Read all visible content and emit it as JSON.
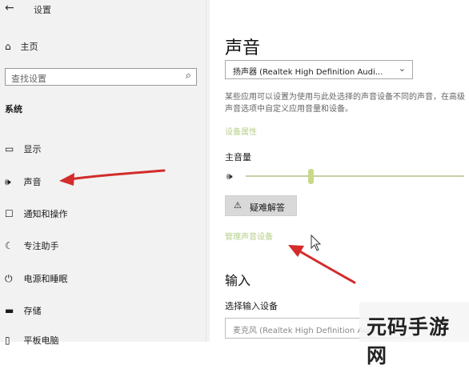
{
  "sidebar": {
    "app_title": "设置",
    "home": "主页",
    "search_placeholder": "查找设置",
    "section": "系统",
    "items": [
      {
        "label": "显示",
        "icon": "monitor-icon"
      },
      {
        "label": "声音",
        "icon": "speaker-icon"
      },
      {
        "label": "通知和操作",
        "icon": "notification-icon"
      },
      {
        "label": "专注助手",
        "icon": "moon-icon"
      },
      {
        "label": "电源和睡眠",
        "icon": "power-icon"
      },
      {
        "label": "存储",
        "icon": "storage-icon"
      },
      {
        "label": "平板电脑",
        "icon": "tablet-icon"
      }
    ]
  },
  "main": {
    "title": "声音",
    "output_device": "扬声器 (Realtek High Definition Audi...",
    "description": "某些应用可以设置为使用与此处选择的声音设备不同的声音，在高级声音选项中自定义应用音量和设备。",
    "device_properties": "设备属性",
    "master_volume_label": "主音量",
    "volume_level": 0.3,
    "troubleshoot": "疑难解答",
    "manage_devices": "管理声音设备",
    "input_title": "输入",
    "input_label": "选择输入设备",
    "input_device": "麦克风 (Realtek High Definition Audi..."
  },
  "watermark": "元码手游网",
  "colors": {
    "arrow": "#d42b2b",
    "link": "#b6cf8a",
    "slider_thumb": "#c9d98a"
  }
}
